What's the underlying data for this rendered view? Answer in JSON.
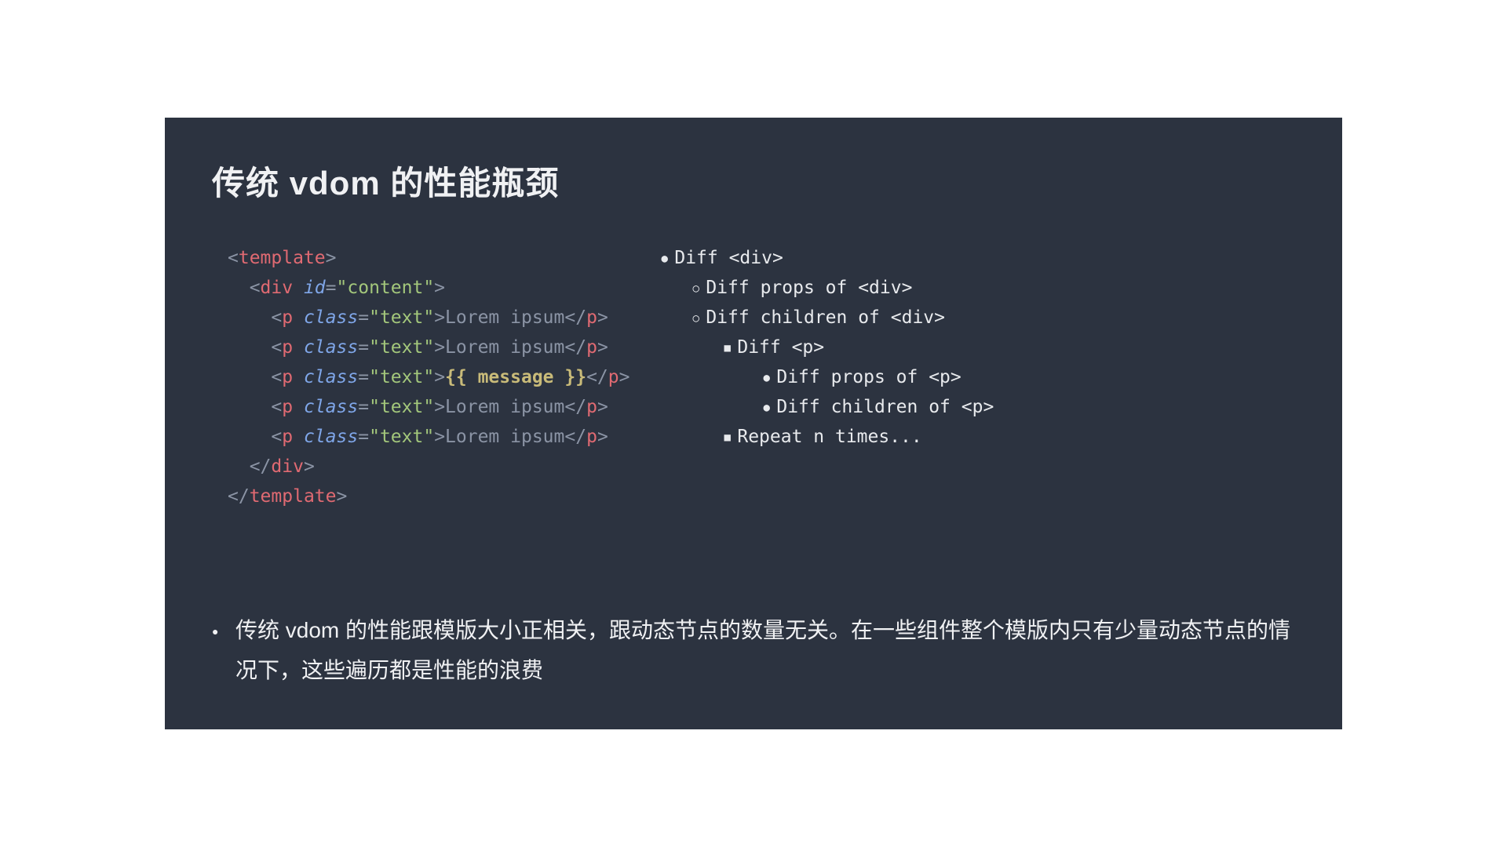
{
  "title": "传统 vdom 的性能瓶颈",
  "code": {
    "line1_open_template": "<template>",
    "line2_open_div_1": "  <",
    "line2_tag": "div",
    "line2_sp": " ",
    "line2_attr": "id",
    "line2_eq": "=",
    "line2_q1": "\"",
    "line2_str": "content",
    "line2_q2": "\"",
    "line2_close": ">",
    "p_indent": "    <",
    "p_tag": "p",
    "p_sp": " ",
    "p_attr": "class",
    "p_eq": "=",
    "p_q1": "\"",
    "p_str": "text",
    "p_q2": "\"",
    "p_close": ">",
    "p_text": "Lorem ipsum",
    "p_end_open": "</",
    "p_end_close": ">",
    "expr": "{{ message }}",
    "div_end_indent": "  </",
    "div_end_tag": "div",
    "div_end_close": ">",
    "tmpl_end_open": "</",
    "tmpl_end_tag": "template",
    "tmpl_end_close": ">"
  },
  "bullets": {
    "l0": "Diff <div>",
    "l1a": "Diff props of <div>",
    "l1b": "Diff children of <div>",
    "l2a": "Diff <p>",
    "l3a": "Diff props of <p>",
    "l3b": "Diff children of <p>",
    "l2b": "Repeat n times..."
  },
  "bottom": "传统 vdom 的性能跟模版大小正相关，跟动态节点的数量无关。在一些组件整个模版内只有少量动态节点的情况下，这些遍历都是性能的浪费"
}
